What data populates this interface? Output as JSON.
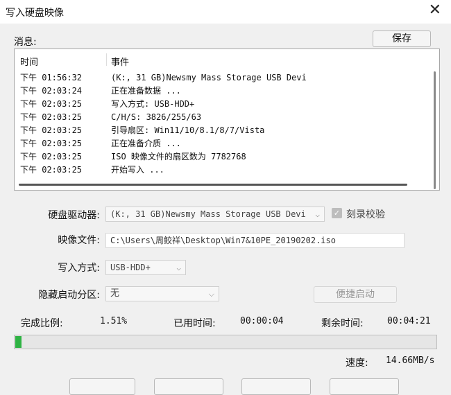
{
  "window": {
    "title": "写入硬盘映像",
    "close_glyph": "✕"
  },
  "messages": {
    "label": "消息:",
    "save_label": "保存",
    "columns": [
      "时间",
      "事件"
    ],
    "rows": [
      {
        "time": "下午 01:56:32",
        "event": "(K:, 31 GB)Newsmy Mass Storage USB Devi"
      },
      {
        "time": "下午 02:03:24",
        "event": "正在准备数据 ..."
      },
      {
        "time": "下午 02:03:25",
        "event": "写入方式: USB-HDD+"
      },
      {
        "time": "下午 02:03:25",
        "event": "C/H/S: 3826/255/63"
      },
      {
        "time": "下午 02:03:25",
        "event": "引导扇区: Win11/10/8.1/8/7/Vista"
      },
      {
        "time": "下午 02:03:25",
        "event": "正在准备介质 ..."
      },
      {
        "time": "下午 02:03:25",
        "event": "ISO 映像文件的扇区数为 7782768"
      },
      {
        "time": "下午 02:03:25",
        "event": "开始写入 ..."
      }
    ]
  },
  "form": {
    "drive_label": "硬盘驱动器:",
    "drive_value": "(K:, 31 GB)Newsmy Mass Storage USB Devi",
    "verify_label": "刻录校验",
    "verify_checked": true,
    "image_label": "映像文件:",
    "image_value": "C:\\Users\\周鲛祥\\Desktop\\Win7&10PE_20190202.iso",
    "method_label": "写入方式:",
    "method_value": "USB-HDD+",
    "hidden_label": "隐藏启动分区:",
    "hidden_value": "无",
    "quick_boot_label": "便捷启动"
  },
  "status": {
    "done_label": "完成比例:",
    "done_value": "1.51%",
    "elapsed_label": "已用时间:",
    "elapsed_value": "00:00:04",
    "remain_label": "剩余时间:",
    "remain_value": "00:04:21",
    "speed_label": "速度:",
    "speed_value": "14.66MB/s",
    "progress_fraction": 0.0151
  },
  "colors": {
    "progress": "#2fb344"
  },
  "icons": {
    "dropdown": "chevron-down-icon",
    "close": "close-icon",
    "check": "check-icon"
  }
}
